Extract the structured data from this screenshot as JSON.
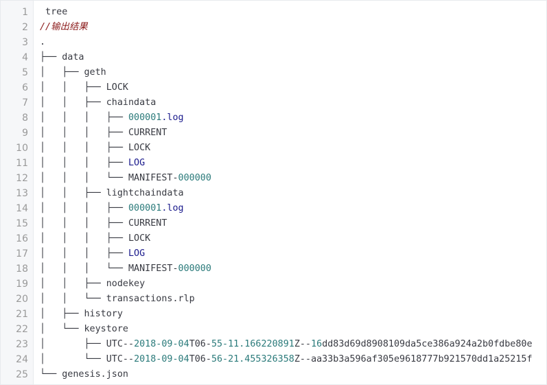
{
  "colors": {
    "text": "#383a42",
    "line_number": "#999999",
    "gutter_bg": "#f6f7f9",
    "comment": "#8b1a1a",
    "number": "#2a7a7a",
    "keyword": "#1a1a8c"
  },
  "lines": [
    {
      "num": "1",
      "segments": [
        {
          "text": " tree",
          "kind": "plain"
        }
      ]
    },
    {
      "num": "2",
      "segments": [
        {
          "text": "//输出结果",
          "kind": "comment"
        }
      ]
    },
    {
      "num": "3",
      "segments": [
        {
          "text": ".",
          "kind": "plain"
        }
      ]
    },
    {
      "num": "4",
      "segments": [
        {
          "text": "├── data",
          "kind": "plain"
        }
      ]
    },
    {
      "num": "5",
      "segments": [
        {
          "text": "│   ├── geth",
          "kind": "plain"
        }
      ]
    },
    {
      "num": "6",
      "segments": [
        {
          "text": "│   │   ├── LOCK",
          "kind": "plain"
        }
      ]
    },
    {
      "num": "7",
      "segments": [
        {
          "text": "│   │   ├── chaindata",
          "kind": "plain"
        }
      ]
    },
    {
      "num": "8",
      "segments": [
        {
          "text": "│   │   │   ├── ",
          "kind": "plain"
        },
        {
          "text": "000001",
          "kind": "number"
        },
        {
          "text": ".log",
          "kind": "keyword"
        }
      ]
    },
    {
      "num": "9",
      "segments": [
        {
          "text": "│   │   │   ├── CURRENT",
          "kind": "plain"
        }
      ]
    },
    {
      "num": "10",
      "segments": [
        {
          "text": "│   │   │   ├── LOCK",
          "kind": "plain"
        }
      ]
    },
    {
      "num": "11",
      "segments": [
        {
          "text": "│   │   │   ├── ",
          "kind": "plain"
        },
        {
          "text": "LOG",
          "kind": "keyword"
        }
      ]
    },
    {
      "num": "12",
      "segments": [
        {
          "text": "│   │   │   └── MANIFEST-",
          "kind": "plain"
        },
        {
          "text": "000000",
          "kind": "number"
        }
      ]
    },
    {
      "num": "13",
      "segments": [
        {
          "text": "│   │   ├── lightchaindata",
          "kind": "plain"
        }
      ]
    },
    {
      "num": "14",
      "segments": [
        {
          "text": "│   │   │   ├── ",
          "kind": "plain"
        },
        {
          "text": "000001",
          "kind": "number"
        },
        {
          "text": ".log",
          "kind": "keyword"
        }
      ]
    },
    {
      "num": "15",
      "segments": [
        {
          "text": "│   │   │   ├── CURRENT",
          "kind": "plain"
        }
      ]
    },
    {
      "num": "16",
      "segments": [
        {
          "text": "│   │   │   ├── LOCK",
          "kind": "plain"
        }
      ]
    },
    {
      "num": "17",
      "segments": [
        {
          "text": "│   │   │   ├── ",
          "kind": "plain"
        },
        {
          "text": "LOG",
          "kind": "keyword"
        }
      ]
    },
    {
      "num": "18",
      "segments": [
        {
          "text": "│   │   │   └── MANIFEST-",
          "kind": "plain"
        },
        {
          "text": "000000",
          "kind": "number"
        }
      ]
    },
    {
      "num": "19",
      "segments": [
        {
          "text": "│   │   ├── nodekey",
          "kind": "plain"
        }
      ]
    },
    {
      "num": "20",
      "segments": [
        {
          "text": "│   │   └── transactions.rlp",
          "kind": "plain"
        }
      ]
    },
    {
      "num": "21",
      "segments": [
        {
          "text": "│   ├── history",
          "kind": "plain"
        }
      ]
    },
    {
      "num": "22",
      "segments": [
        {
          "text": "│   └── keystore",
          "kind": "plain"
        }
      ]
    },
    {
      "num": "23",
      "segments": [
        {
          "text": "│       ├── UTC--",
          "kind": "plain"
        },
        {
          "text": "2018-09-04",
          "kind": "number"
        },
        {
          "text": "T06-",
          "kind": "plain"
        },
        {
          "text": "55-11.166220891",
          "kind": "number"
        },
        {
          "text": "Z--",
          "kind": "plain"
        },
        {
          "text": "16",
          "kind": "number"
        },
        {
          "text": "dd83d69d8908109da5ce386a924a2b0fdbe80e",
          "kind": "plain"
        }
      ]
    },
    {
      "num": "24",
      "segments": [
        {
          "text": "│       └── UTC--",
          "kind": "plain"
        },
        {
          "text": "2018-09-04",
          "kind": "number"
        },
        {
          "text": "T06-",
          "kind": "plain"
        },
        {
          "text": "56-21.455326358",
          "kind": "number"
        },
        {
          "text": "Z--",
          "kind": "plain"
        },
        {
          "text": "aa33b3a596af305e9618777b921570dd1a25215f",
          "kind": "plain"
        }
      ]
    },
    {
      "num": "25",
      "segments": [
        {
          "text": "└── genesis.json",
          "kind": "plain"
        }
      ]
    }
  ]
}
